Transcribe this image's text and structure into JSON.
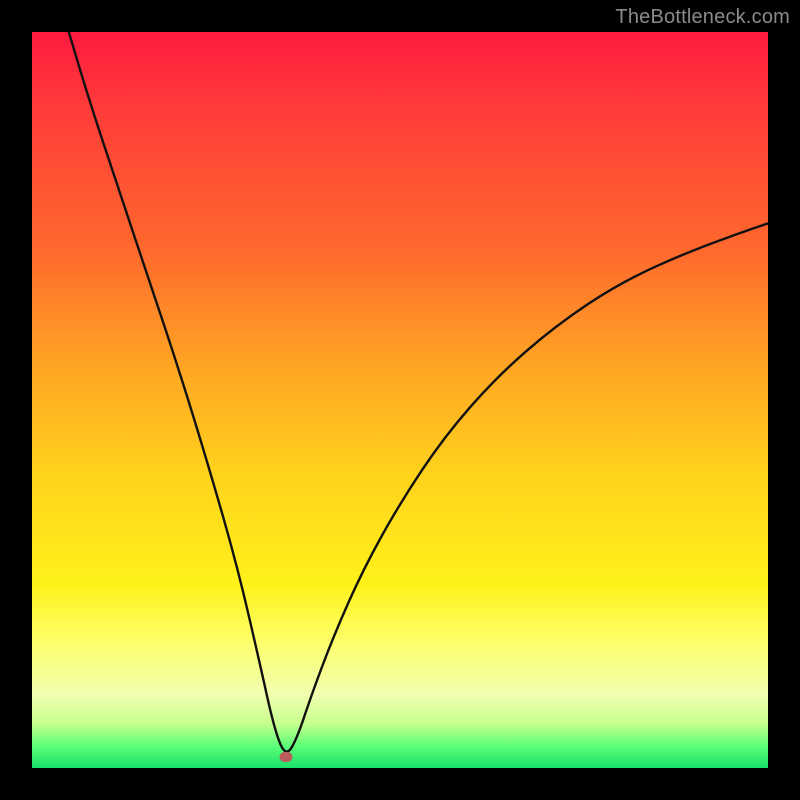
{
  "watermark": {
    "text": "TheBottleneck.com"
  },
  "colors": {
    "curve": "#111111",
    "marker": "#bb5b5b",
    "frame": "#000000"
  },
  "chart_data": {
    "type": "line",
    "title": "",
    "xlabel": "",
    "ylabel": "",
    "xlim": [
      0,
      100
    ],
    "ylim": [
      0,
      100
    ],
    "grid": false,
    "legend": false,
    "comment": "V-shaped bottleneck curve. Minimum (optimal point) at x≈34.5, y≈1.5. Left arm starts near top-left (x≈5, y≈100) and drops steeply to the min. Right arm rises from the min with decreasing slope toward top-right (x≈100, y≈74). Vertical gradient background encodes y: red=bad (high), green=good (low).",
    "min_point": {
      "x": 34.5,
      "y": 1.5
    },
    "series": [
      {
        "name": "bottleneck-curve",
        "x": [
          5,
          8,
          12,
          16,
          20,
          24,
          28,
          31,
          33,
          34.5,
          36,
          38,
          41,
          45,
          50,
          56,
          63,
          71,
          80,
          90,
          100
        ],
        "y": [
          100,
          90,
          78,
          66,
          54,
          41,
          27,
          14,
          5,
          1.5,
          4,
          10,
          18,
          27,
          36,
          45,
          53,
          60,
          66,
          70.5,
          74
        ]
      }
    ],
    "marker": {
      "x": 34.5,
      "y": 1.5
    }
  }
}
